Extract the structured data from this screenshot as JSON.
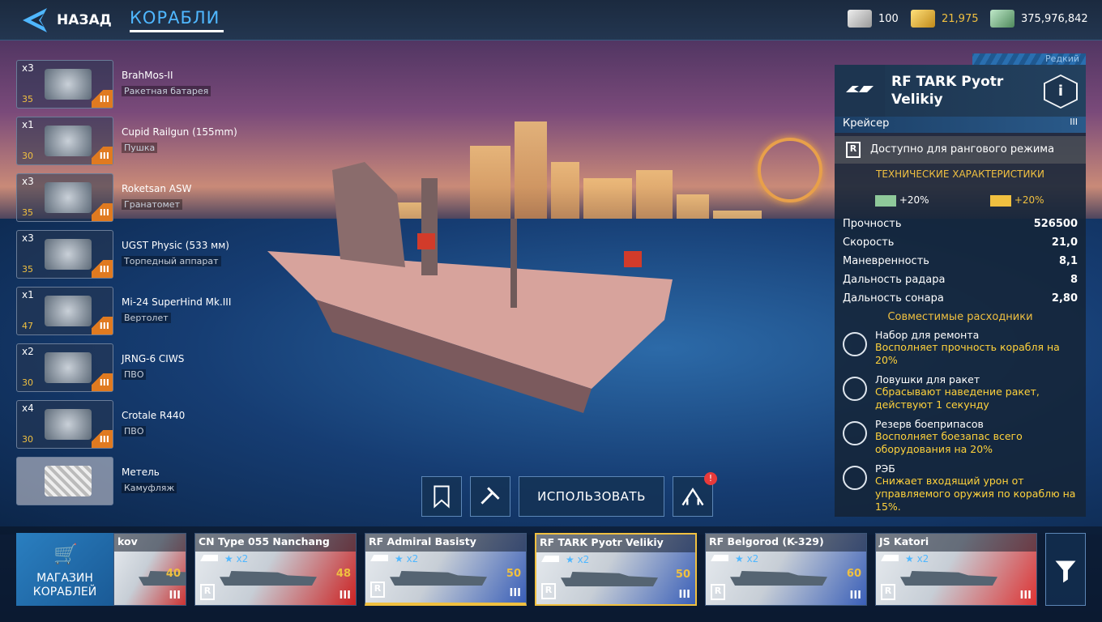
{
  "header": {
    "back_label": "НАЗАД",
    "tab_title": "КОРАБЛИ",
    "currencies": [
      {
        "icon": "silver-bar-icon",
        "value": "100",
        "color": "#ffffff"
      },
      {
        "icon": "gold-bar-icon",
        "value": "21,975",
        "color": "#f0c040"
      },
      {
        "icon": "cash-icon",
        "value": "375,976,842",
        "color": "#ffffff"
      }
    ]
  },
  "equipment": [
    {
      "count": "x3",
      "level": "35",
      "tier": "III",
      "name": "BrahMos-II",
      "type": "Ракетная батарея"
    },
    {
      "count": "x1",
      "level": "30",
      "tier": "III",
      "name": "Cupid Railgun (155mm)",
      "type": "Пушка"
    },
    {
      "count": "x3",
      "level": "35",
      "tier": "III",
      "name": "Roketsan ASW",
      "type": "Гранатомет"
    },
    {
      "count": "x3",
      "level": "35",
      "tier": "III",
      "name": "UGST Physic (533 мм)",
      "type": "Торпедный аппарат"
    },
    {
      "count": "x1",
      "level": "47",
      "tier": "III",
      "name": "Mi-24 SuperHind Mk.III",
      "type": "Вертолет"
    },
    {
      "count": "x2",
      "level": "30",
      "tier": "III",
      "name": "JRNG-6 CIWS",
      "type": "ПВО"
    },
    {
      "count": "x4",
      "level": "30",
      "tier": "III",
      "name": "Crotale R440",
      "type": "ПВО"
    },
    {
      "count": "",
      "level": "",
      "tier": "",
      "name": "Метель",
      "type": "Камуфляж"
    }
  ],
  "panel": {
    "rarity": "Редкий",
    "ship_name": "RF TARK Pyotr Velikiy",
    "class_label": "Крейсер",
    "tier": "III",
    "ranked": "Доступно для рангового режима",
    "specs_header": "ТЕХНИЧЕСКИЕ ХАРАКТЕРИСТИКИ",
    "bonus_cash": "+20%",
    "bonus_gold": "+20%",
    "stats": [
      {
        "label": "Прочность",
        "value": "526500"
      },
      {
        "label": "Скорость",
        "value": "21,0"
      },
      {
        "label": "Маневренность",
        "value": "8,1"
      },
      {
        "label": "Дальность радара",
        "value": "8"
      },
      {
        "label": "Дальность сонара",
        "value": "2,80"
      }
    ],
    "consumables_header": "Совместимые расходники",
    "consumables": [
      {
        "name": "Набор для ремонта",
        "desc": "Восполняет прочность корабля на 20%",
        "icon": "repair-kit-icon"
      },
      {
        "name": "Ловушки для ракет",
        "desc": "Сбрасывают наведение ракет, действуют 1 секунду",
        "icon": "missile-decoy-icon"
      },
      {
        "name": "Резерв боеприпасов",
        "desc": "Восполняет боезапас всего оборудования на 20%",
        "icon": "ammo-reserve-icon"
      },
      {
        "name": "РЭБ",
        "desc": "Снижает входящий урон от управляемого оружия по кораблю на 15%.",
        "icon": "ecm-icon"
      }
    ]
  },
  "actions": {
    "use_label": "ИСПОЛЬЗОВАТЬ",
    "notif": "!"
  },
  "fleet": {
    "shop_label_1": "МАГАЗИН",
    "shop_label_2": "КОРАБЛЕЙ",
    "ships": [
      {
        "name": "kov",
        "stars": "",
        "level": "40",
        "tier": "III",
        "flag": "#c33"
      },
      {
        "name": "CN Type 055 Nanchang",
        "stars": "★ x2",
        "level": "48",
        "tier": "III",
        "flag": "#c22"
      },
      {
        "name": "RF Admiral Basisty",
        "stars": "★ x2",
        "level": "50",
        "tier": "III",
        "flag": "#3a5fb8"
      },
      {
        "name": "RF TARK Pyotr Velikiy",
        "stars": "★ x2",
        "level": "50",
        "tier": "III",
        "flag": "#3a5fb8"
      },
      {
        "name": "RF Belgorod (K-329)",
        "stars": "★ x2",
        "level": "60",
        "tier": "III",
        "flag": "#3a5fb8"
      },
      {
        "name": "JS Katori",
        "stars": "★ x2",
        "level": "",
        "tier": "III",
        "flag": "#d33"
      }
    ]
  }
}
